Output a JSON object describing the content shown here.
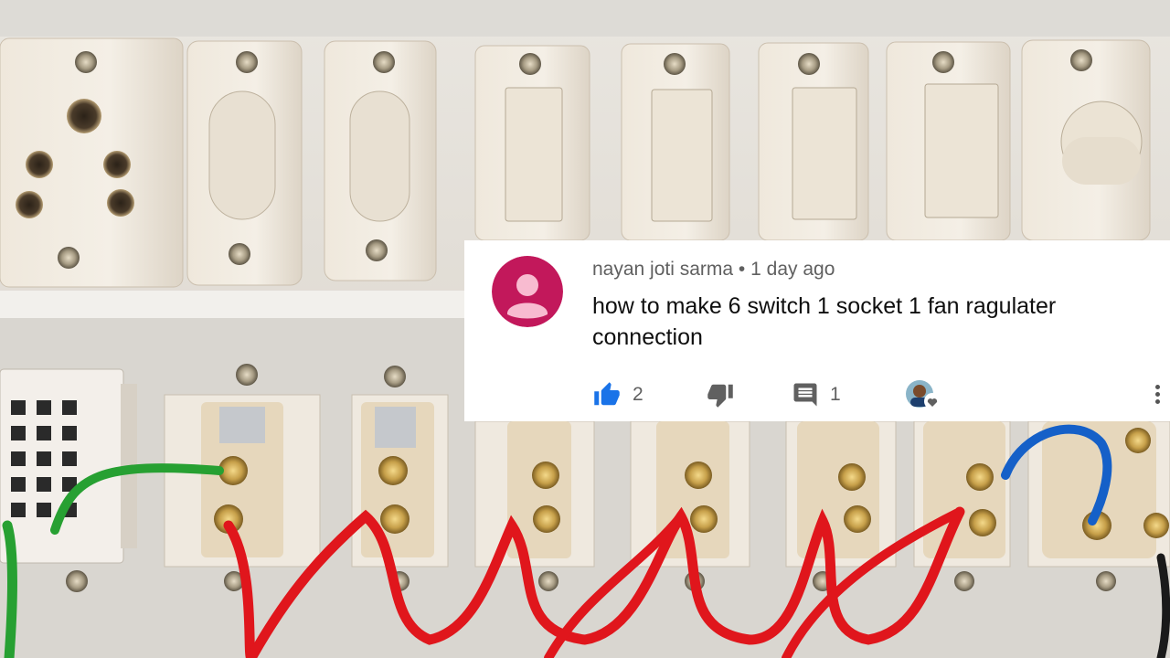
{
  "comment": {
    "author": "nayan joti sarma",
    "separator": "•",
    "time": "1 day ago",
    "text": "how to make 6 switch 1 socket 1 fan ragulater connection",
    "likes": "2",
    "replies": "1"
  },
  "icons": {
    "avatar": "default-avatar-icon",
    "like": "thumbs-up-icon",
    "dislike": "thumbs-down-icon",
    "reply": "comment-icon",
    "creator_heart": "creator-heart-icon",
    "menu": "more-vert-icon"
  },
  "colors": {
    "like_active": "#1a73e8",
    "avatar_bg": "#c2185b",
    "wire_red": "#e0161c",
    "wire_green": "#27a032",
    "wire_blue": "#1560c8"
  }
}
